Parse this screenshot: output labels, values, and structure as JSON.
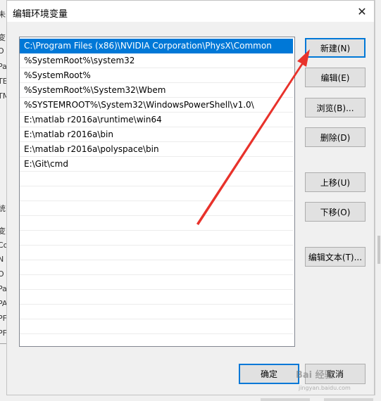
{
  "dialog": {
    "title": "编辑环境变量",
    "close_glyph": "✕"
  },
  "paths": [
    "C:\\Program Files (x86)\\NVIDIA Corporation\\PhysX\\Common",
    "%SystemRoot%\\system32",
    "%SystemRoot%",
    "%SystemRoot%\\System32\\Wbem",
    "%SYSTEMROOT%\\System32\\WindowsPowerShell\\v1.0\\",
    "E:\\matlab r2016a\\runtime\\win64",
    "E:\\matlab r2016a\\bin",
    "E:\\matlab r2016a\\polyspace\\bin",
    "E:\\Git\\cmd"
  ],
  "selected_index": 0,
  "buttons": {
    "new": "新建(N)",
    "edit": "编辑(E)",
    "browse": "浏览(B)...",
    "delete": "删除(D)",
    "move_up": "上移(U)",
    "move_down": "下移(O)",
    "edit_text": "编辑文本(T)...",
    "ok": "确定",
    "cancel": "取消"
  },
  "background_fragments": [
    "未",
    "变",
    "O",
    "Pa",
    "TE",
    "TM",
    "统",
    "变",
    "Co",
    "N",
    "O",
    "Pa",
    "PA",
    "PF",
    "PF"
  ],
  "watermark": {
    "text": "Bai 经验",
    "sub": "jingyan.baidu.com"
  },
  "colors": {
    "selection": "#0078d7",
    "annotation_arrow": "#e8322b"
  }
}
